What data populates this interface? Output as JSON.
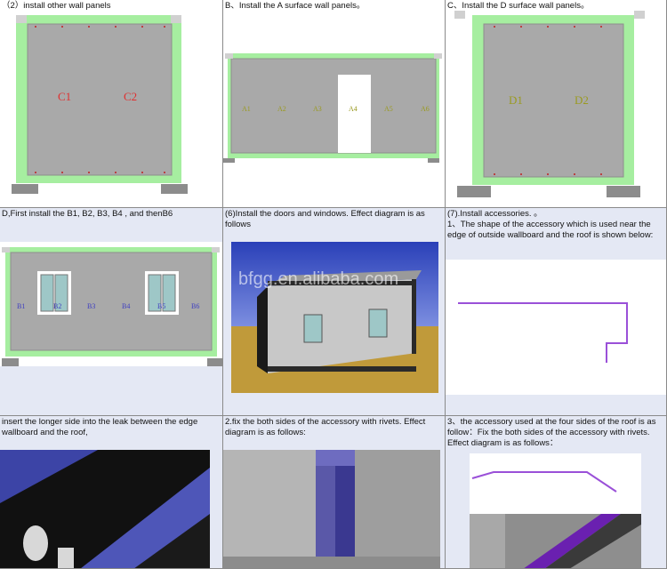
{
  "cells": [
    {
      "caption": "（2）install other wall panels",
      "labels": [
        "C1",
        "C2"
      ]
    },
    {
      "caption": "B、Install the A surface wall panels。",
      "labels": [
        "A1",
        "A2",
        "A3",
        "A4",
        "A5",
        "A6"
      ]
    },
    {
      "caption": "C、Install the D surface wall panels。",
      "labels": [
        "D1",
        "D2"
      ]
    },
    {
      "caption": "D,First install the B1, B2, B3, B4 , and thenB6",
      "labels": [
        "B1",
        "B2",
        "B3",
        "B4",
        "B5",
        "B6"
      ]
    },
    {
      "caption": "(6)Install the doors and windows. Effect diagram is as follows",
      "watermark": "bfgg.en.alibaba.com"
    },
    {
      "caption_lines": [
        "(7).Install accessories. 。",
        "1、The shape of the accessory which is used near the edge of outside wallboard and the roof is shown below:"
      ]
    },
    {
      "caption": "insert the longer side into the leak between the edge wallboard and the roof,"
    },
    {
      "caption": "2.fix the both sides of the accessory with rivets. Effect diagram is as follows:"
    },
    {
      "caption": "3、the accessory used at the four sides of the roof is as follow：Fix the both sides of the accessory with rivets. Effect diagram is as follows："
    }
  ],
  "colors": {
    "panel": "#a9a9a9",
    "frame": "#a6eea0",
    "label_red": "#e03030",
    "label_olive": "#9a9a20",
    "accessory": "#9a50d8"
  }
}
